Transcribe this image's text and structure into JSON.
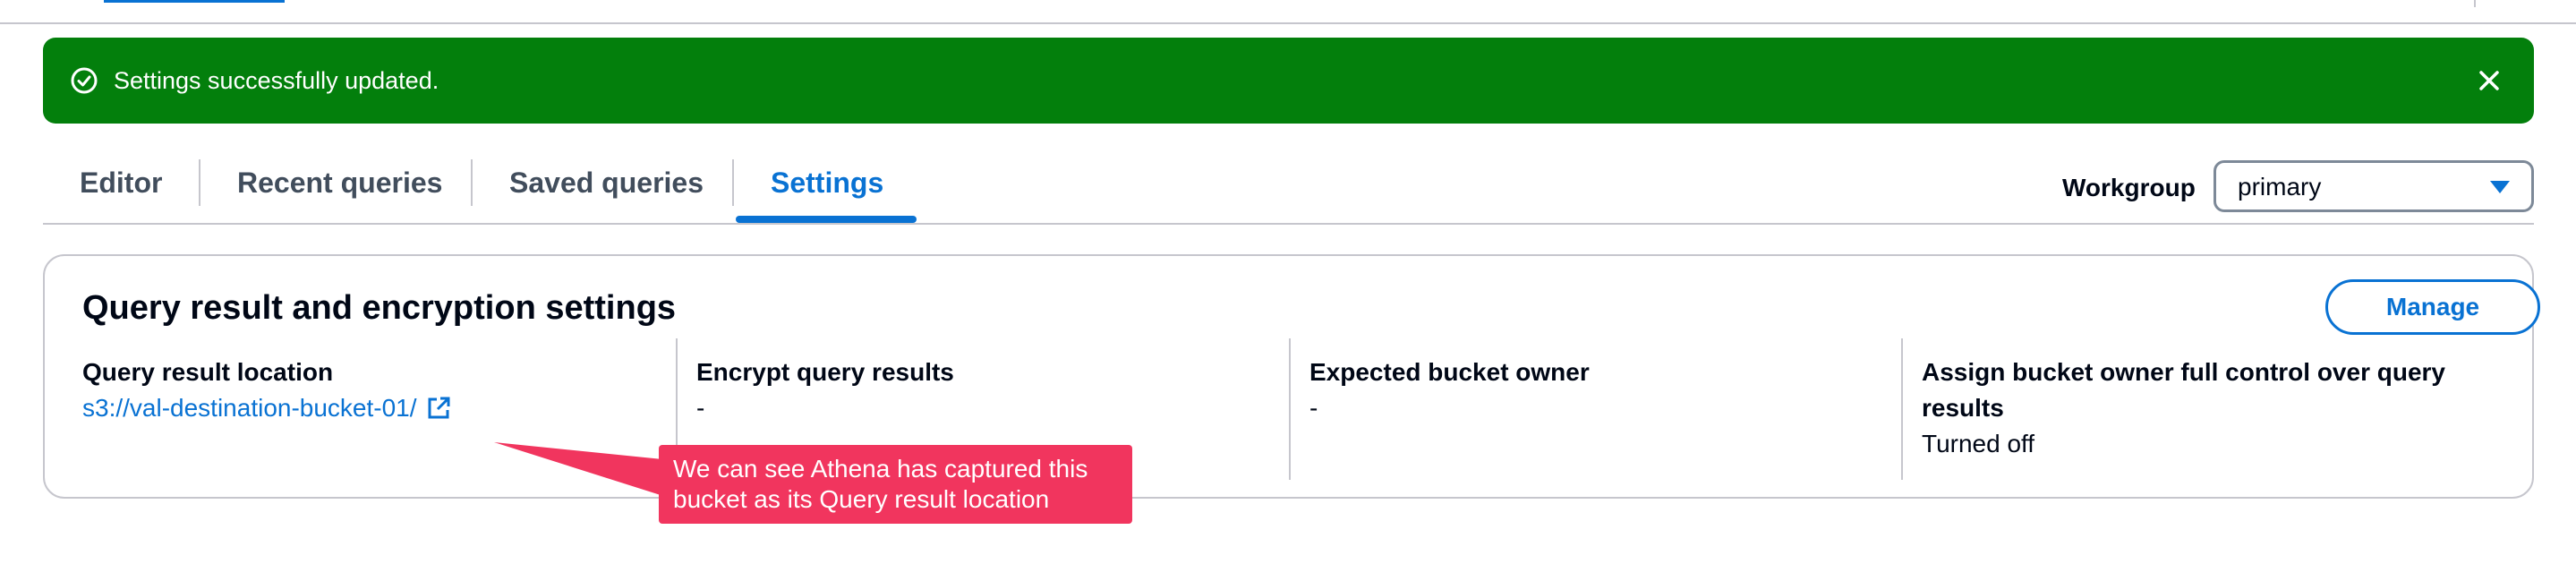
{
  "flash": {
    "message": "Settings successfully updated.",
    "type": "success",
    "color": "#037f0c"
  },
  "tabs": [
    {
      "label": "Editor",
      "active": false
    },
    {
      "label": "Recent queries",
      "active": false
    },
    {
      "label": "Saved queries",
      "active": false
    },
    {
      "label": "Settings",
      "active": true
    }
  ],
  "workgroup": {
    "label": "Workgroup",
    "selected": "primary"
  },
  "panel": {
    "title": "Query result and encryption settings",
    "manage_label": "Manage",
    "columns": [
      {
        "heading": "Query result location",
        "value": "s3://val-destination-bucket-01/",
        "is_link": true
      },
      {
        "heading": "Encrypt query results",
        "value": "-"
      },
      {
        "heading": "Expected bucket owner",
        "value": "-"
      },
      {
        "heading": "Assign bucket owner full control over query results",
        "value": "Turned off"
      }
    ]
  },
  "annotation": {
    "text": "We can see Athena has captured this bucket as its Query result location",
    "color": "#f1355e"
  },
  "colors": {
    "accent": "#0972d3",
    "text": "#000716",
    "tab_inactive": "#414d5c",
    "border": "#c6c6cd"
  }
}
